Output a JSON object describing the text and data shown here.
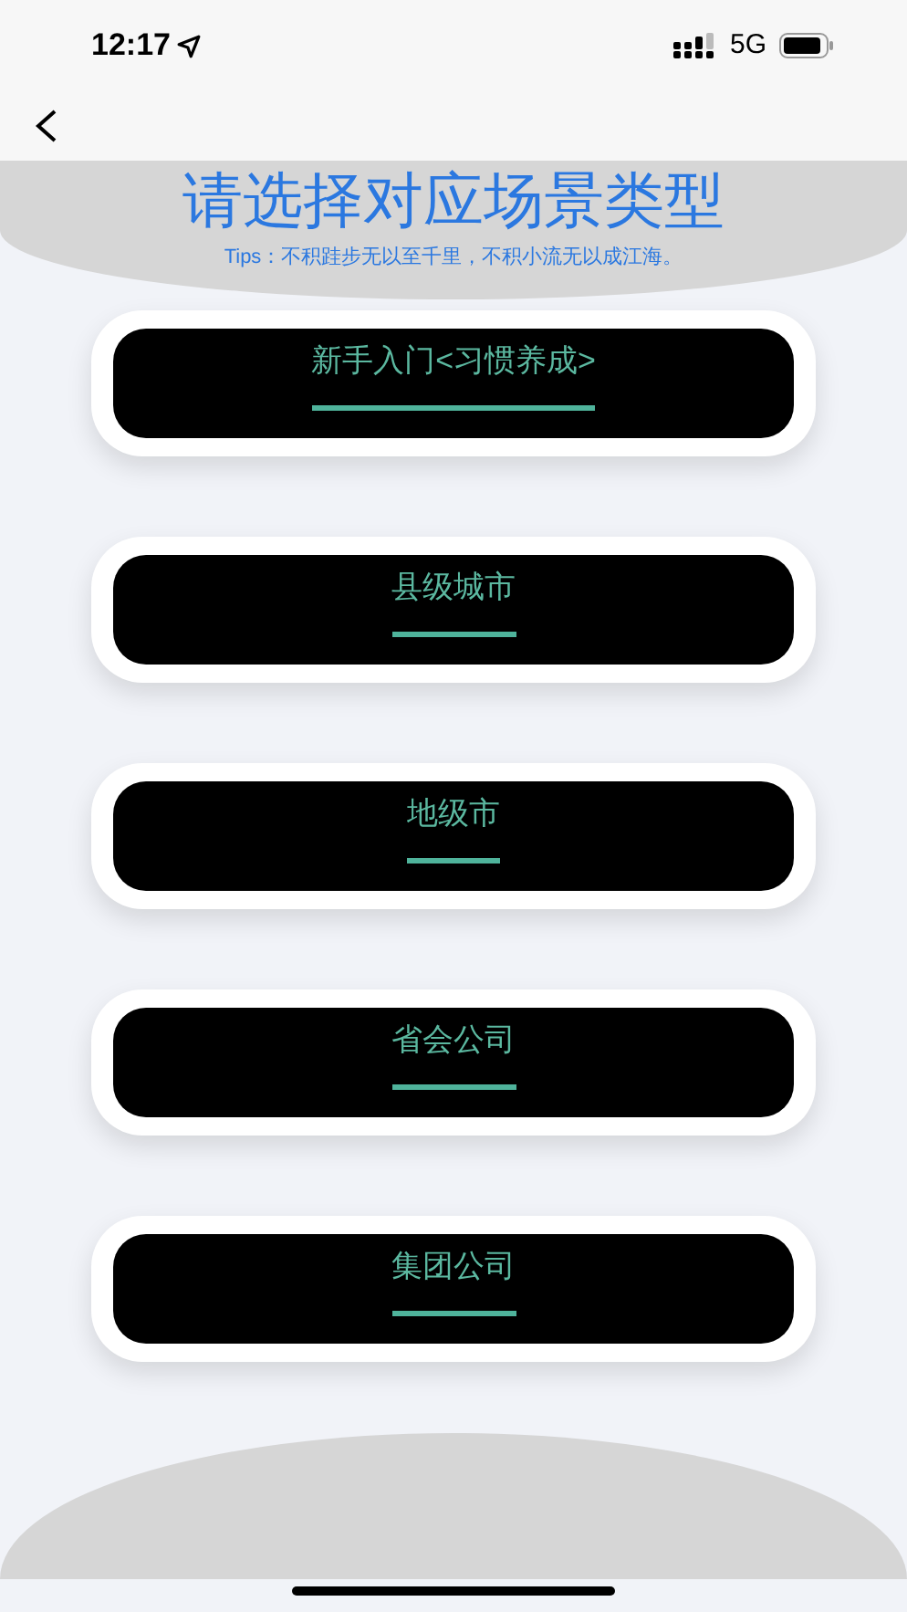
{
  "status_bar": {
    "time": "12:17",
    "network": "5G"
  },
  "header": {
    "title": "请选择对应场景类型",
    "tips": "Tips：不积跬步无以至千里，不积小流无以成江海。"
  },
  "scenes": [
    {
      "label": "新手入门<习惯养成>"
    },
    {
      "label": "县级城市"
    },
    {
      "label": "地级市"
    },
    {
      "label": "省会公司"
    },
    {
      "label": "集团公司"
    }
  ]
}
